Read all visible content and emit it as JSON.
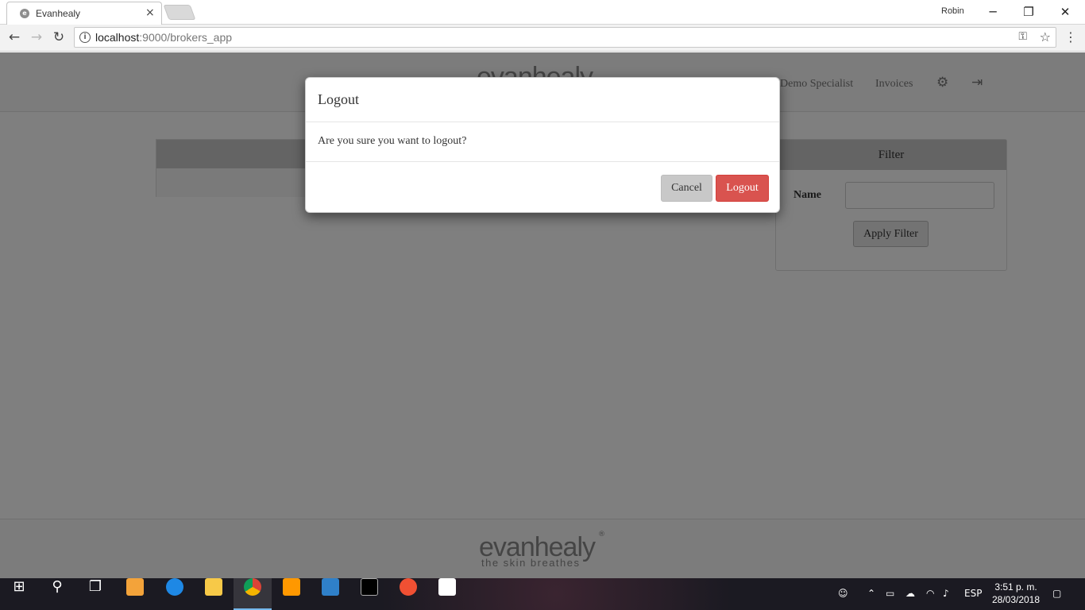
{
  "browser": {
    "tab_title": "Evanhealy",
    "tab_close": "×",
    "profile_name": "Robin",
    "url_host": "localhost",
    "url_path": ":9000/brokers_app",
    "window_buttons": {
      "minimize": "─",
      "restore": "❐",
      "close": "✕"
    }
  },
  "app": {
    "logo_text": "evanhealy",
    "nav": [
      "Demo Specialist",
      "Invoices"
    ],
    "icons": [
      "gear-icon",
      "logout-icon"
    ]
  },
  "filter": {
    "title": "Filter",
    "name_label": "Name",
    "name_value": "",
    "apply_label": "Apply Filter"
  },
  "modal": {
    "title": "Logout",
    "message": "Are you sure you want to logout?",
    "cancel_label": "Cancel",
    "logout_label": "Logout"
  },
  "footer": {
    "logo_text": "evanhealy",
    "registered": "®",
    "tagline": "the skin breathes"
  },
  "taskbar": {
    "language": "ESP",
    "time": "3:51 p. m.",
    "date": "28/03/2018",
    "apps": [
      "start-icon",
      "search-icon",
      "task-view-icon",
      "store-icon",
      "edge-icon",
      "file-explorer-icon",
      "chrome-icon",
      "sublime-icon",
      "vscode-icon",
      "terminal-icon",
      "git-icon",
      "sticky-notes-icon"
    ]
  },
  "colors": {
    "logout_button": "#d9534f",
    "overlay": "rgba(0,0,0,0.5)"
  }
}
